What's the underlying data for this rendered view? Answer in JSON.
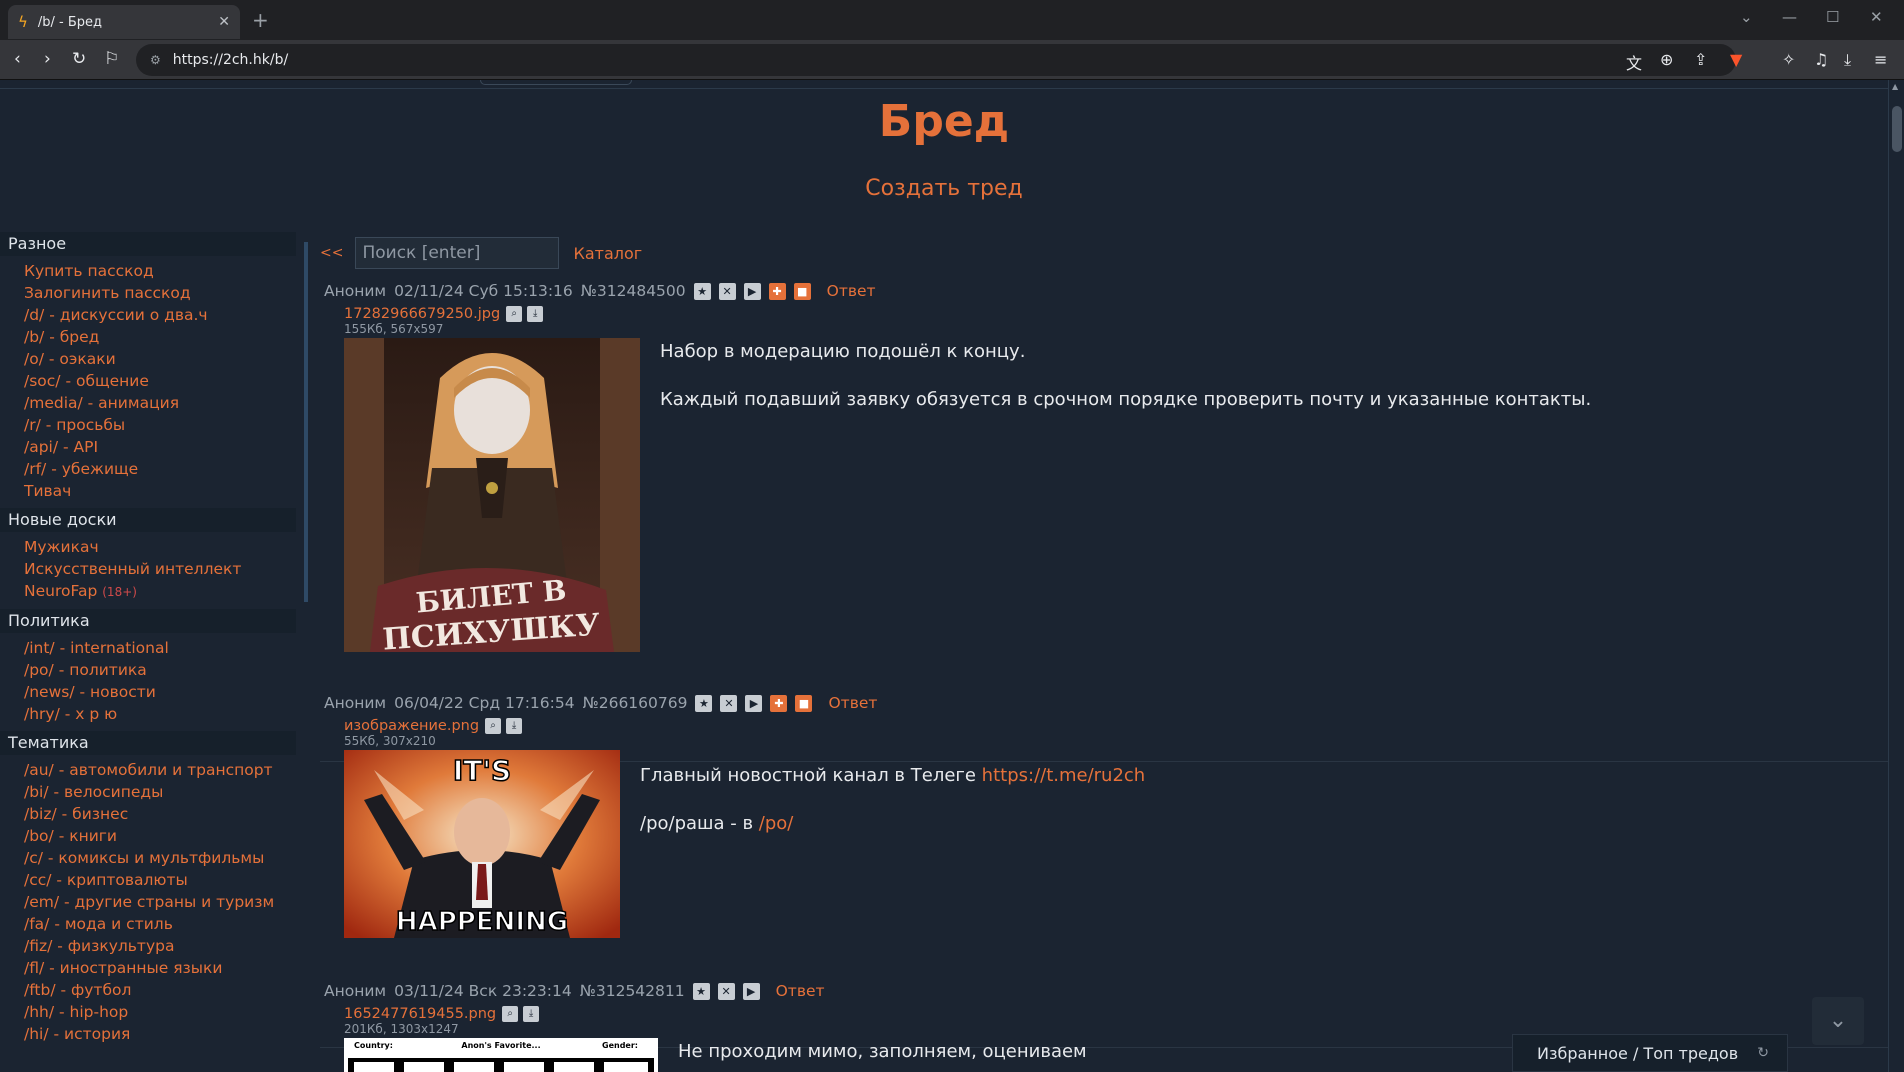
{
  "browser": {
    "tab_title": "/b/ - Бред",
    "url": "https://2ch.hk/b/"
  },
  "board": {
    "title": "Бред",
    "create_thread": "Создать тред",
    "back": "<<",
    "search_placeholder": "Поиск [enter]",
    "catalog": "Каталог"
  },
  "sidebar": {
    "groups": [
      {
        "title": "Разное",
        "items": [
          "Купить пасскод",
          "Залогинить пасскод",
          "/d/ - дискуссии о два.ч",
          "/b/ - бред",
          "/o/ - оэкаки",
          "/soc/ - общение",
          "/media/ - анимация",
          "/r/ - просьбы",
          "/api/ - API",
          "/rf/ - убежище",
          "Тивач"
        ]
      },
      {
        "title": "Новые доски",
        "items": [
          "Мужикач",
          "Искусственный интеллект",
          "NeuroFap"
        ],
        "tag": "(18+)"
      },
      {
        "title": "Политика",
        "items": [
          "/int/ - international",
          "/po/ - политика",
          "/news/ - новости",
          "/hry/ - х р ю"
        ]
      },
      {
        "title": "Тематика",
        "items": [
          "/au/ - автомобили и транспорт",
          "/bi/ - велосипеды",
          "/biz/ - бизнес",
          "/bo/ - книги",
          "/c/ - комиксы и мультфильмы",
          "/cc/ - криптовалюты",
          "/em/ - другие страны и туризм",
          "/fa/ - мода и стиль",
          "/fiz/ - физкультура",
          "/fl/ - иностранные языки",
          "/ftb/ - футбол",
          "/hh/ - hip-hop",
          "/hi/ - история"
        ]
      }
    ]
  },
  "threads": [
    {
      "author": "Аноним",
      "date": "02/11/24 Суб 15:13:16",
      "num": "№312484500",
      "reply": "Ответ",
      "file_name": "17282966679250.jpg",
      "file_meta": "155Кб, 567x597",
      "image_caption_1": "БИЛЕТ В",
      "image_caption_2": "ПСИХУШКУ",
      "text1": "Набор в модерацию подошёл к концу.",
      "text2": "Каждый подавший заявку обязуется в срочном порядке проверить почту и указанные контакты."
    },
    {
      "author": "Аноним",
      "date": "06/04/22 Срд 17:16:54",
      "num": "№266160769",
      "reply": "Ответ",
      "file_name": "изображение.png",
      "file_meta": "55Кб, 307x210",
      "image_caption_1": "IT'S",
      "image_caption_2": "HAPPENING",
      "text1_prefix": "Главный новостной канал в Телеге ",
      "text1_link": "https://t.me/ru2ch",
      "text2_prefix": "/po/раша - в ",
      "text2_link": "/po/"
    },
    {
      "author": "Аноним",
      "date": "03/11/24 Вск 23:23:14",
      "num": "№312542811",
      "reply": "Ответ",
      "file_name": "1652477619455.png",
      "file_meta": "201Кб, 1303x1247",
      "image_header": [
        "Country:",
        "Anon's Favorite...",
        "Gender:"
      ],
      "text1": "Не проходим мимо, заполняем, оцениваем"
    }
  ],
  "bottom_panel": "Избранное / Топ тредов"
}
